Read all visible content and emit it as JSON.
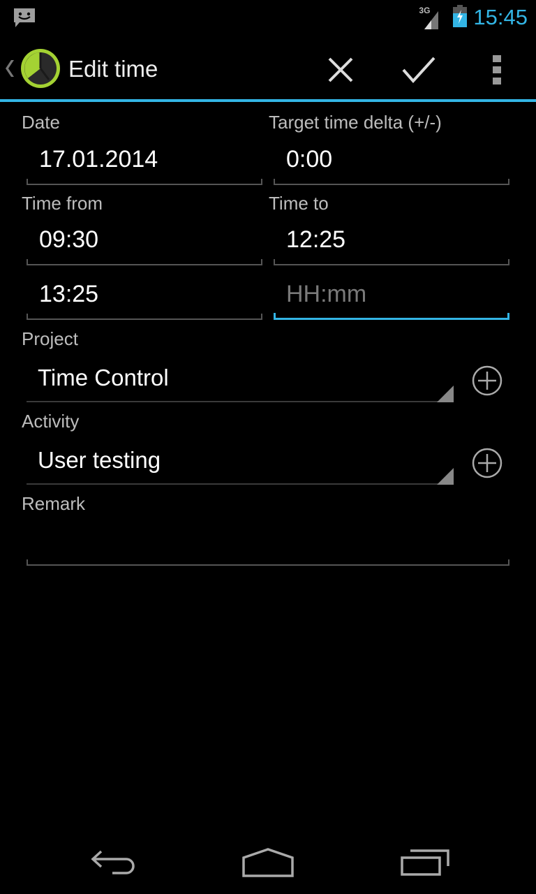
{
  "status_bar": {
    "time": "15:45",
    "network": "3G",
    "icons": [
      "chat-notification-icon",
      "signal-3g-icon",
      "battery-charging-icon"
    ]
  },
  "action_bar": {
    "title": "Edit time",
    "icons": [
      "up-chevron-icon",
      "app-clock-icon"
    ],
    "actions": [
      {
        "name": "cancel",
        "icon": "close-icon"
      },
      {
        "name": "save",
        "icon": "checkmark-icon"
      },
      {
        "name": "overflow",
        "icon": "more-vert-icon"
      }
    ]
  },
  "form": {
    "date": {
      "label": "Date",
      "value": "17.01.2014"
    },
    "target_delta": {
      "label": "Target time delta (+/-)",
      "value": "0:00"
    },
    "time_from": {
      "label": "Time from",
      "values": [
        "09:30",
        "13:25"
      ]
    },
    "time_to": {
      "label": "Time to",
      "values": [
        "12:25",
        ""
      ],
      "placeholder": "HH:mm"
    },
    "project": {
      "label": "Project",
      "selected": "Time Control",
      "add_icon": "add-circle-icon"
    },
    "activity": {
      "label": "Activity",
      "selected": "User testing",
      "add_icon": "add-circle-icon"
    },
    "remark": {
      "label": "Remark",
      "value": ""
    }
  },
  "nav_bar": {
    "buttons": [
      "back",
      "home",
      "recent-apps"
    ]
  },
  "colors": {
    "accent": "#33b5e5",
    "app_icon_green": "#a4d233"
  }
}
